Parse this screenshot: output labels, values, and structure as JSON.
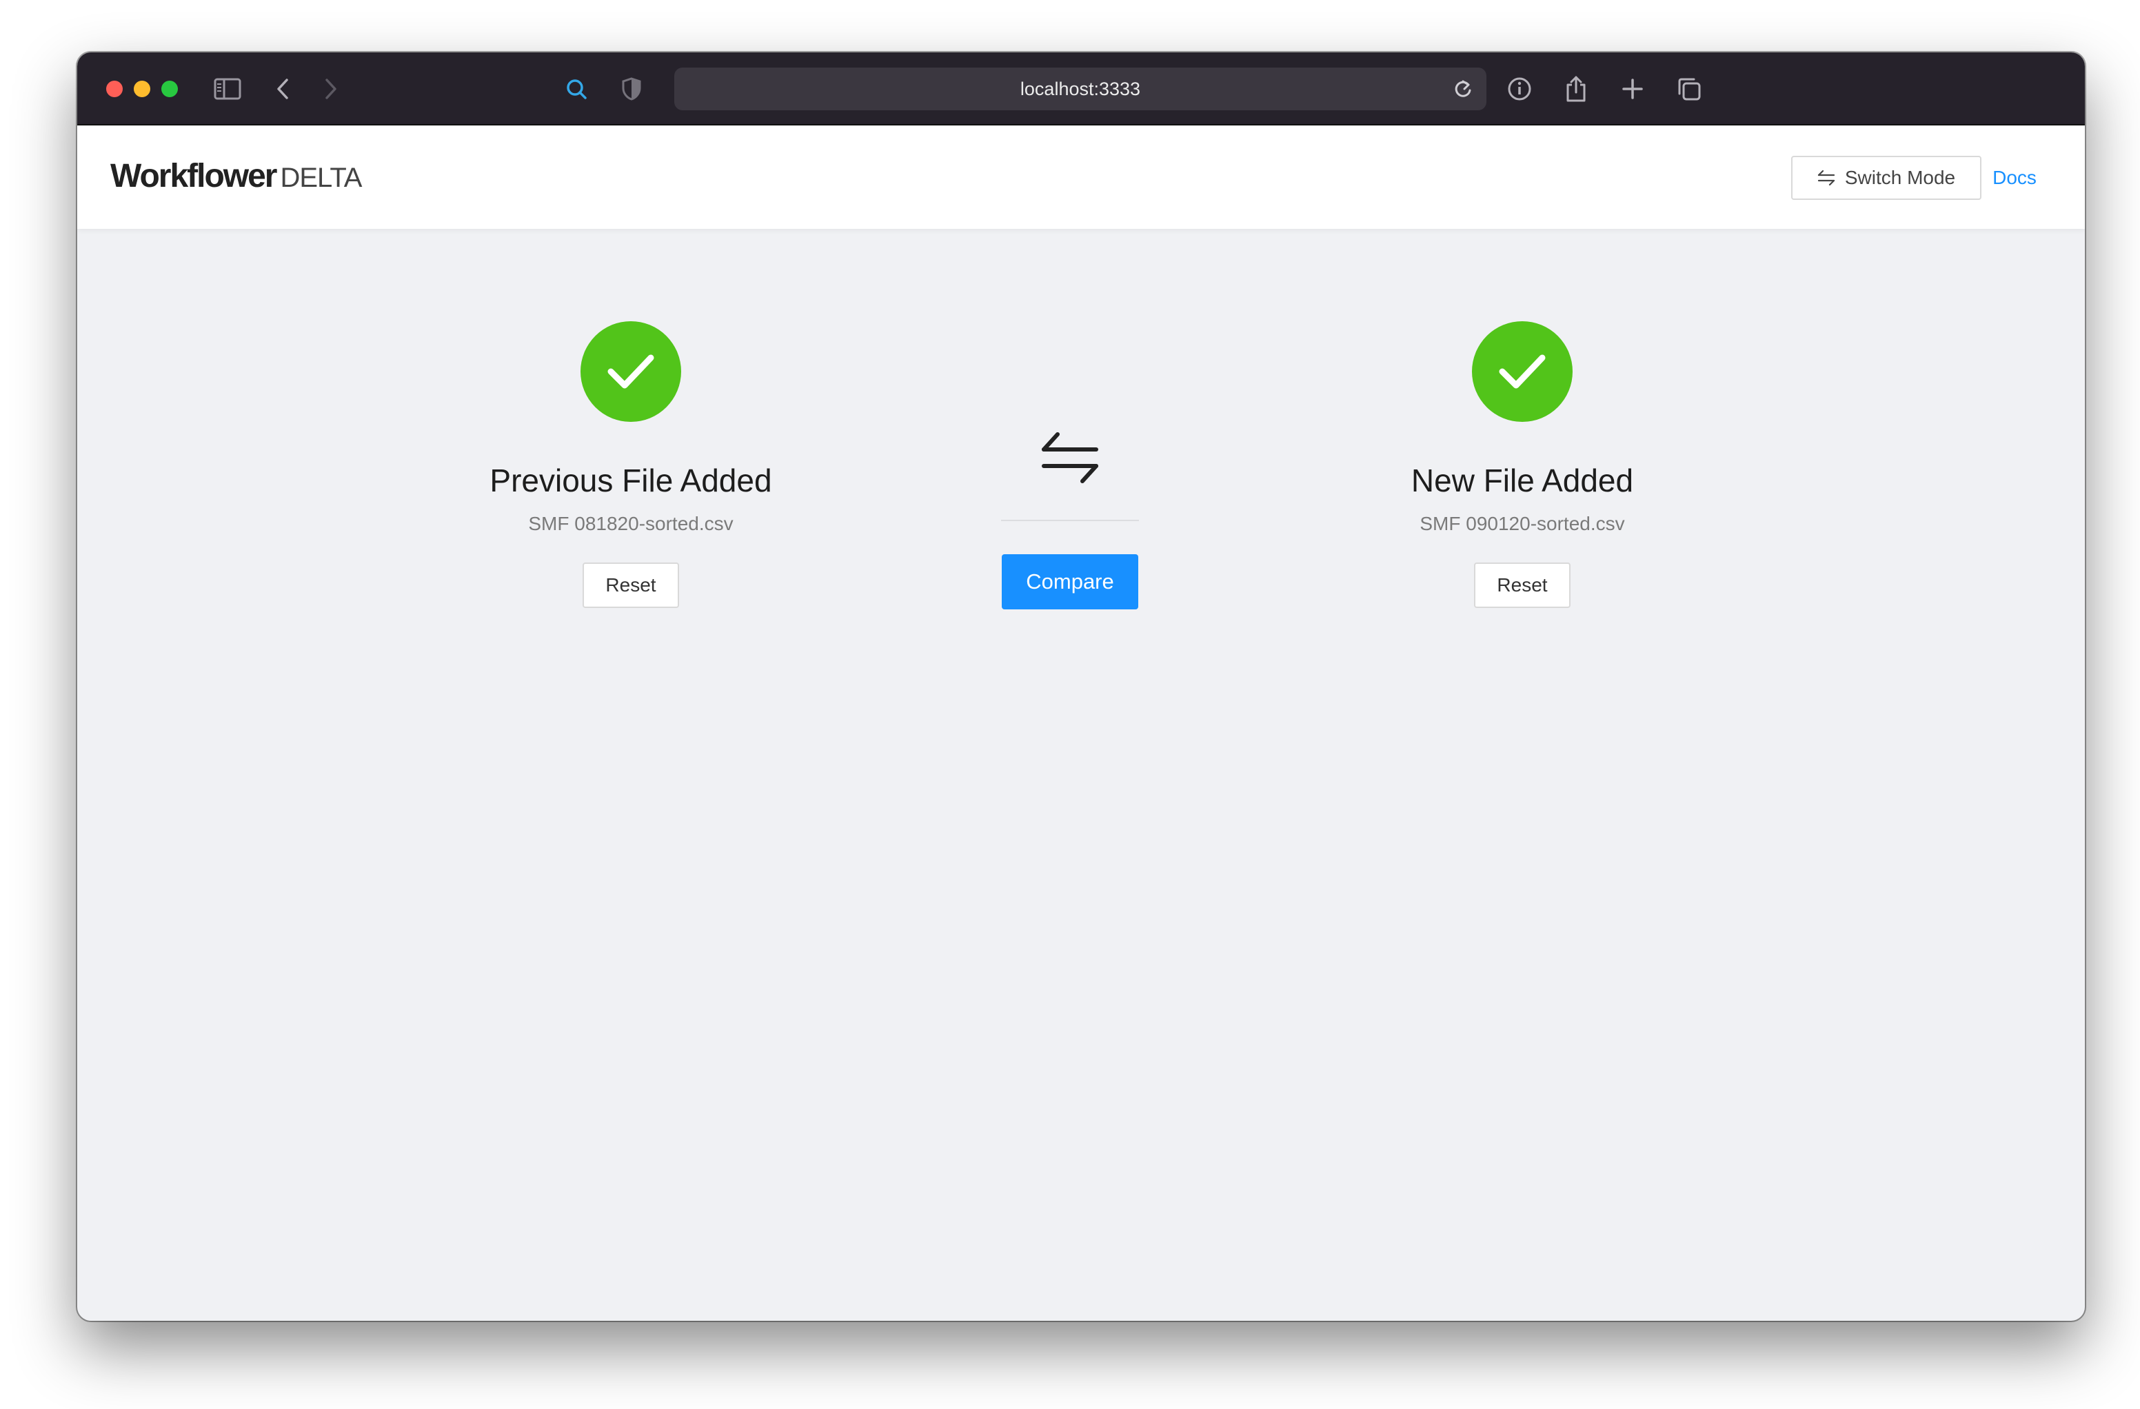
{
  "browser": {
    "url": "localhost:3333"
  },
  "header": {
    "logo_main": "Workflower",
    "logo_sub": "DELTA",
    "switch_mode_label": "Switch Mode",
    "docs_label": "Docs"
  },
  "previous": {
    "title": "Previous File Added",
    "filename": "SMF 081820-sorted.csv",
    "reset_label": "Reset"
  },
  "compare": {
    "label": "Compare"
  },
  "new": {
    "title": "New File Added",
    "filename": "SMF 090120-sorted.csv",
    "reset_label": "Reset"
  },
  "colors": {
    "accent": "#1890ff",
    "success": "#52c41a",
    "toolbar": "#26222b",
    "background": "#f0f1f4"
  },
  "icons": {
    "swap": "arrows-swap-icon",
    "check": "check-icon"
  }
}
